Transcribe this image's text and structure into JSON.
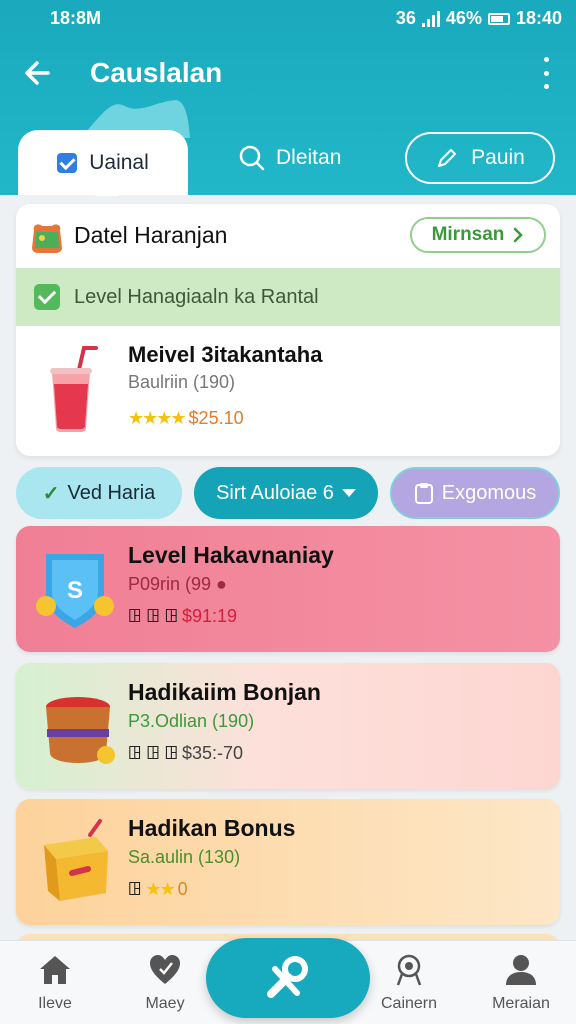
{
  "status": {
    "time": "18:8M",
    "right_text": "36",
    "battery_text": "46%",
    "clock": "18:40"
  },
  "appbar": {
    "title": "Causlalan"
  },
  "tabs": {
    "active": "Uainal",
    "plain": "Dleitan",
    "outline": "Pauin"
  },
  "detail": {
    "title": "Datel Haranjan",
    "more_label": "Mirnsan",
    "level_text": "Level Hanagiaaln ka Rantal",
    "product_name": "Meivel 3itakantaha",
    "product_sub": "Baulriin (190)",
    "product_price": "$25.10"
  },
  "filters": {
    "chip1": "Ved Haria",
    "chip2": "Sirt Auloiae 6",
    "chip3": "Exgomous"
  },
  "offers": [
    {
      "name": "Level Hakavnaniay",
      "sub": "P09rin (99 ●",
      "meta": "ꖸ ꖸ ꖸ",
      "price": "$91:19"
    },
    {
      "name": "Hadikaiim Bonjan",
      "sub": "P3.Odlian (190)",
      "meta": "ꖸ ꖸ ꖸ",
      "price": "$35:-70"
    },
    {
      "name": "Hadikan Bonus",
      "sub": "Sa.aulin (130)",
      "meta": "ꖸ",
      "price": "0"
    }
  ],
  "nav": {
    "home": "Ileve",
    "maey": "Maey",
    "carn": "Cainern",
    "mer": "Meraian"
  },
  "colors": {
    "header": "#1aa9bd",
    "accent": "#15a3b8",
    "offer_pink": "#f07f95",
    "level_green": "#cdeac4"
  },
  "icons": {
    "back": "arrow-left-icon",
    "more": "more-vertical-icon",
    "check": "check-square-icon",
    "search": "search-icon",
    "edit": "pencil-icon",
    "bag": "shopping-bag-icon",
    "drink": "drink-cup-icon",
    "home": "home-icon",
    "heart": "heart-icon",
    "fab": "wrench-icon",
    "award": "award-icon",
    "user": "user-icon"
  }
}
